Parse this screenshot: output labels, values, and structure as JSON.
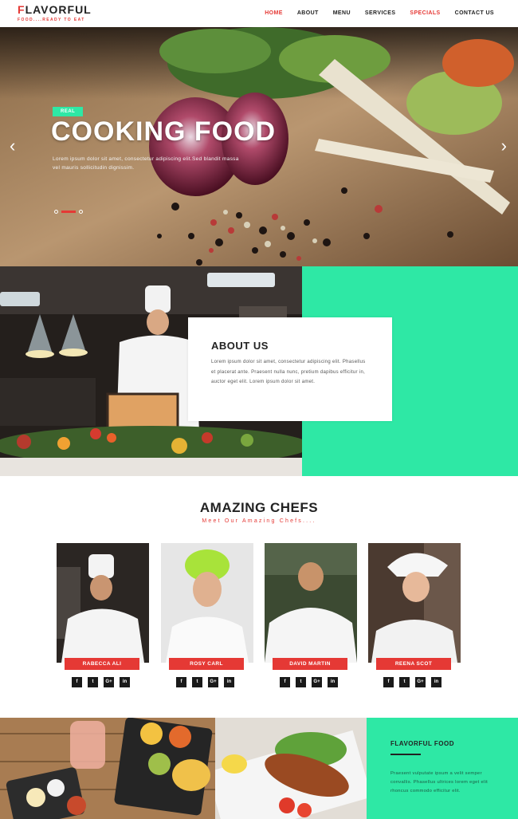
{
  "header": {
    "logo_first": "F",
    "logo_rest": "LAVORFUL",
    "tagline": "FOOD....READY TO EAT",
    "nav": [
      {
        "label": "HOME",
        "state": "active"
      },
      {
        "label": "ABOUT",
        "state": ""
      },
      {
        "label": "MENU",
        "state": ""
      },
      {
        "label": "SERVICES",
        "state": ""
      },
      {
        "label": "SPECIALS",
        "state": "accent"
      },
      {
        "label": "CONTACT US",
        "state": ""
      }
    ]
  },
  "hero": {
    "badge": "REAL",
    "title": "COOKING FOOD",
    "text": "Lorem ipsum dolor sit amet, consectetur adipiscing elit.Sed blandit massa vel mauris sollicitudin dignissim.",
    "prev_icon": "chevron-left-icon",
    "next_icon": "chevron-right-icon",
    "active_slide": 2,
    "slide_count": 3
  },
  "about": {
    "title": "ABOUT US",
    "text": "Lorem ipsum dolor sit amet, consectetur adipiscing elit. Phasellus et placerat ante. Praesent nulla nunc, pretium dapibus efficitur in, auctor eget elit. Lorem ipsum dolor sit amet."
  },
  "chefs": {
    "title": "AMAZING CHEFS",
    "subtitle": "Meet Our Amazing Chefs....",
    "social_labels": [
      "f",
      "t",
      "G+",
      "in"
    ],
    "social_icons": [
      "facebook-icon",
      "twitter-icon",
      "google-plus-icon",
      "linkedin-icon"
    ],
    "members": [
      {
        "name": "RABECCA ALI"
      },
      {
        "name": "ROSY CARL"
      },
      {
        "name": "DAVID MARTIN"
      },
      {
        "name": "REENA SCOT"
      }
    ]
  },
  "feature": {
    "title": "FLAVORFUL FOOD",
    "text": "Praesent vulputate ipsum a velit semper convallis. Phasellus ultrices lorem eget elit rhoncus commodo efficitur elit."
  },
  "colors": {
    "accent_red": "#e53935",
    "accent_green": "#2ee8a5",
    "dark": "#222222"
  }
}
